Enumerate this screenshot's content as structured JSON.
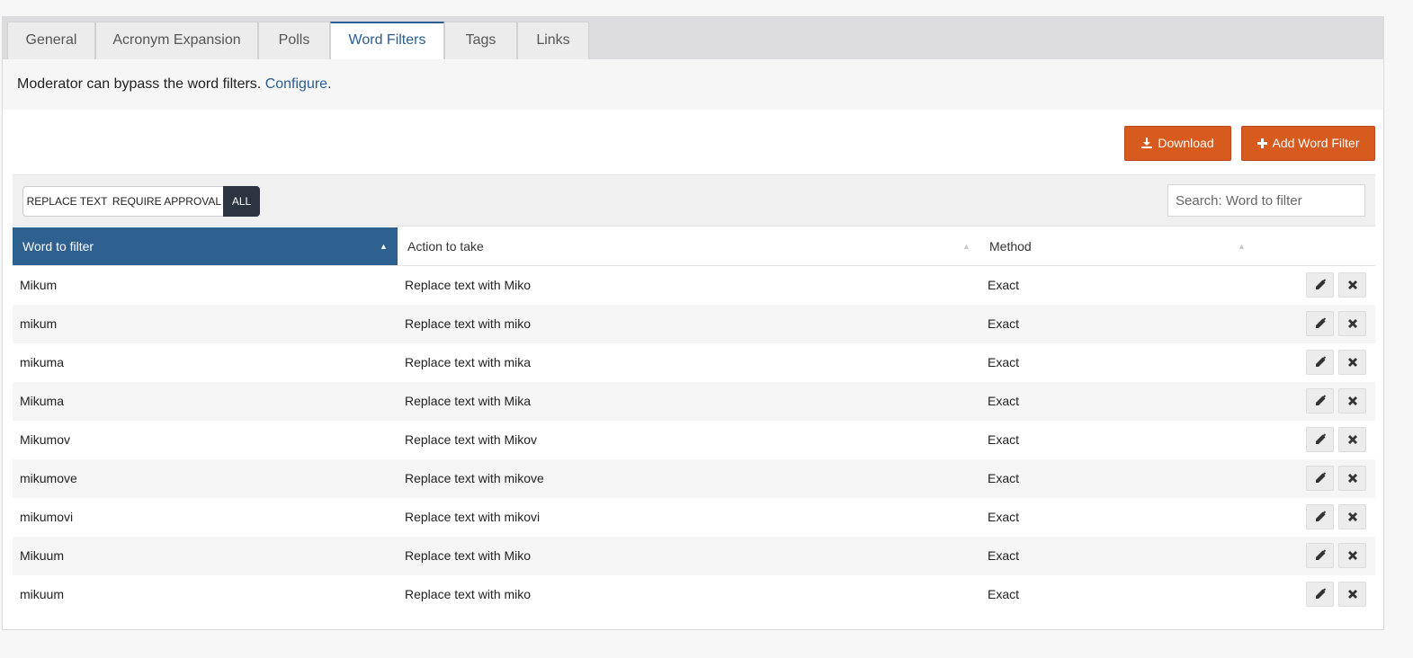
{
  "tabs": [
    {
      "label": "General"
    },
    {
      "label": "Acronym Expansion"
    },
    {
      "label": "Polls"
    },
    {
      "label": "Word Filters"
    },
    {
      "label": "Tags"
    },
    {
      "label": "Links"
    }
  ],
  "info": {
    "text": "Moderator can bypass the word filters.",
    "link": "Configure",
    "suffix": "."
  },
  "buttons": {
    "download": "Download",
    "add": "Add Word Filter"
  },
  "filters": [
    {
      "label": "REPLACE TEXT"
    },
    {
      "label": "REQUIRE APPROVAL"
    },
    {
      "label": "ALL"
    }
  ],
  "search": {
    "placeholder": "Search: Word to filter"
  },
  "columns": {
    "word": "Word to filter",
    "action": "Action to take",
    "method": "Method"
  },
  "rows": [
    {
      "word": "Mikum",
      "action": "Replace text with Miko",
      "method": "Exact"
    },
    {
      "word": "mikum",
      "action": "Replace text with miko",
      "method": "Exact"
    },
    {
      "word": "mikuma",
      "action": "Replace text with mika",
      "method": "Exact"
    },
    {
      "word": "Mikuma",
      "action": "Replace text with Mika",
      "method": "Exact"
    },
    {
      "word": "Mikumov",
      "action": "Replace text with Mikov",
      "method": "Exact"
    },
    {
      "word": "mikumove",
      "action": "Replace text with mikove",
      "method": "Exact"
    },
    {
      "word": "mikumovi",
      "action": "Replace text with mikovi",
      "method": "Exact"
    },
    {
      "word": "Mikuum",
      "action": "Replace text with Miko",
      "method": "Exact"
    },
    {
      "word": "mikuum",
      "action": "Replace text with miko",
      "method": "Exact"
    }
  ],
  "colors": {
    "accent": "#d75a1e",
    "sorted_header": "#2f6190",
    "active_tab": "#2a5d91",
    "active_filter": "#2b3440"
  },
  "icons": {
    "download": "download-icon",
    "add": "plus-icon",
    "edit": "pencil-icon",
    "delete": "close-icon",
    "sort": "sort-arrow-icon"
  }
}
